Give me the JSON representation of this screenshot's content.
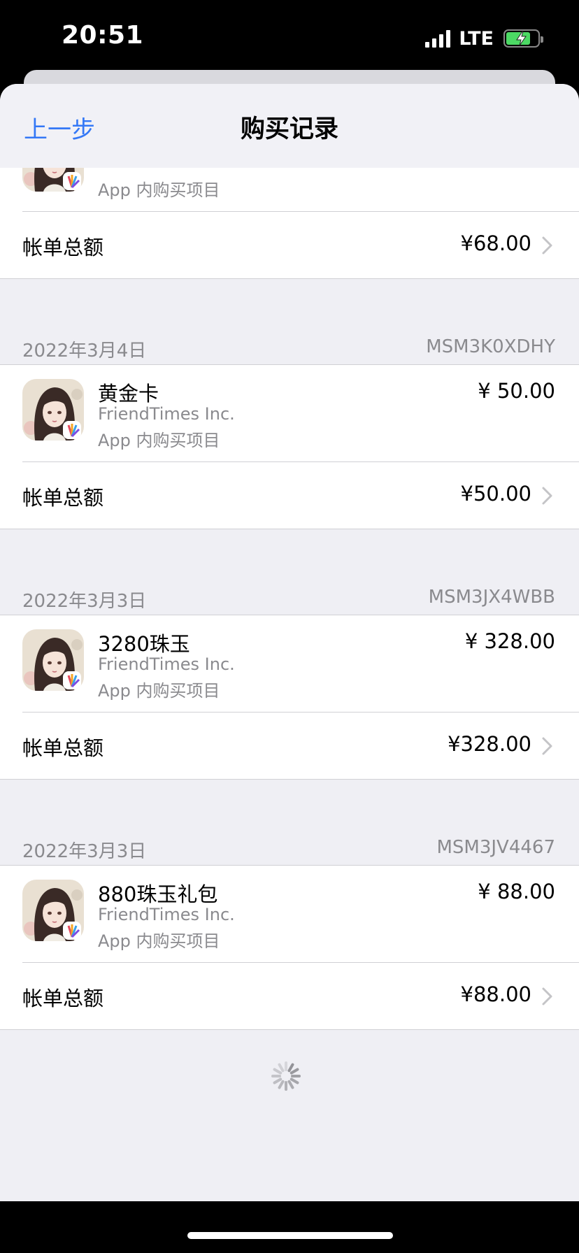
{
  "status": {
    "time": "20:51",
    "network": "LTE",
    "battery_level": 0.75,
    "battery_charging": true
  },
  "nav": {
    "back_label": "上一步",
    "title": "购买记录"
  },
  "colors": {
    "accent": "#3478f6",
    "secondary_text": "#8a8a8e",
    "background": "#efeff4"
  },
  "partial_entry": {
    "type": "App 内购买项目",
    "total_label": "帐单总额",
    "total": "¥68.00"
  },
  "sections": [
    {
      "date": "2022年3月4日",
      "order_id": "MSM3K0XDHY",
      "item": {
        "name": "黄金卡",
        "developer": "FriendTimes Inc.",
        "type": "App 内购买项目",
        "price": "¥ 50.00"
      },
      "total_label": "帐单总额",
      "total": "¥50.00"
    },
    {
      "date": "2022年3月3日",
      "order_id": "MSM3JX4WBB",
      "item": {
        "name": "3280珠玉",
        "developer": "FriendTimes Inc.",
        "type": "App 内购买项目",
        "price": "¥ 328.00"
      },
      "total_label": "帐单总额",
      "total": "¥328.00"
    },
    {
      "date": "2022年3月3日",
      "order_id": "MSM3JV4467",
      "item": {
        "name": "880珠玉礼包",
        "developer": "FriendTimes Inc.",
        "type": "App 内购买项目",
        "price": "¥ 88.00"
      },
      "total_label": "帐单总额",
      "total": "¥88.00"
    }
  ],
  "icons": {
    "app_icon": "anime-girl-app-icon",
    "chevron": "chevron-right-icon",
    "spinner": "loading-spinner-icon"
  }
}
